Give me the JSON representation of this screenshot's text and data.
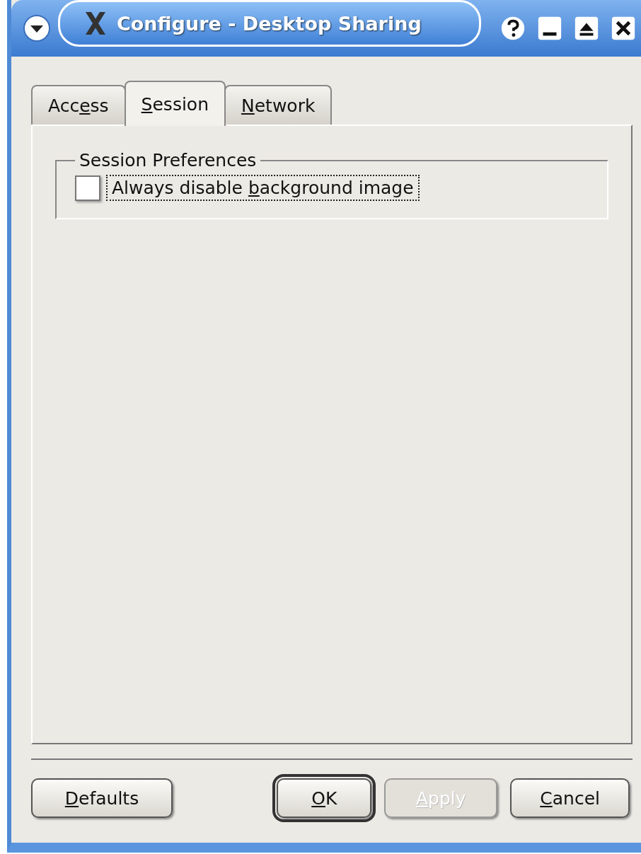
{
  "window": {
    "title": "Configure - Desktop Sharing"
  },
  "tabs": [
    {
      "before": "Acc",
      "key": "e",
      "after": "ss",
      "selected": false
    },
    {
      "key": "S",
      "after": "ession",
      "selected": true
    },
    {
      "key": "N",
      "after": "etwork",
      "selected": false
    }
  ],
  "group": {
    "title": "Session Preferences",
    "checkbox": {
      "before": "Always disable ",
      "key": "b",
      "after": "ackground image",
      "checked": false,
      "focused": true
    }
  },
  "buttons": [
    {
      "key": "D",
      "after": "efaults",
      "disabled": false,
      "default": false
    },
    {
      "key": "O",
      "after": "K",
      "disabled": false,
      "default": true
    },
    {
      "key": "A",
      "after": "pply",
      "disabled": true,
      "default": false
    },
    {
      "key": "C",
      "after": "ancel",
      "disabled": false,
      "default": false
    }
  ]
}
